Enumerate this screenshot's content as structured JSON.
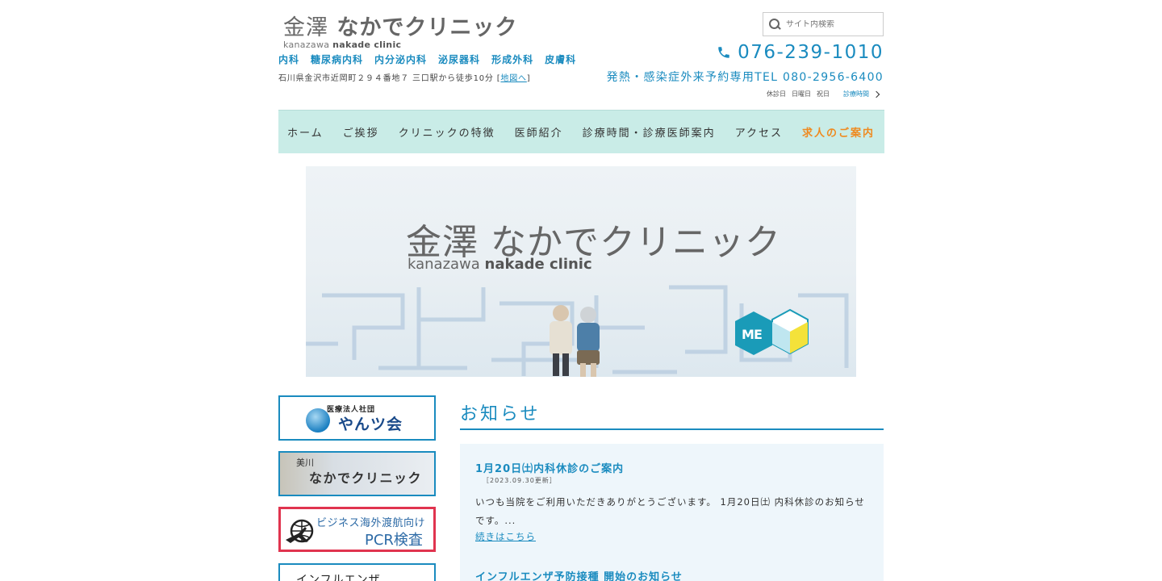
{
  "header": {
    "logo_kanji": "金澤",
    "logo_kana": "なかでクリニック",
    "logo_en_light": "kanazawa",
    "logo_en_bold": "nakade clinic",
    "search_placeholder": "サイト内検索",
    "departments": [
      "内科",
      "糖尿病内科",
      "内分泌内科",
      "泌尿器科",
      "形成外科",
      "皮膚科"
    ],
    "phone": "076-239-1010",
    "address": "石川県金沢市近岡町２９４番地７ 三口駅から徒歩10分",
    "map_link": "地図へ",
    "fever_line": "発熱・感染症外来予約専用TEL 080-2956-6400",
    "holiday_label": "休診日",
    "holiday_sun": "日曜日",
    "holiday_nat": "祝日",
    "hours_link": "診療時間"
  },
  "nav": {
    "items": [
      "ホーム",
      "ご挨拶",
      "クリニックの特徴",
      "医師紹介",
      "診療時間・診療医師案内",
      "アクセス",
      "求人のご案内"
    ]
  },
  "hero": {
    "title": "金澤 なかでクリニック",
    "sub_light": "kanazawa",
    "sub_bold": "nakade clinic",
    "badge": "ME"
  },
  "sidebar": {
    "banner1_small": "医療法人社団",
    "banner1_big": "やんツ会",
    "banner2_small": "美川",
    "banner2_big": "なかでクリニック",
    "banner3_line1": "ビジネス海外渡航向け",
    "banner3_line2": "PCR検査",
    "banner4_line1": "インフルエンザ"
  },
  "news": {
    "title": "お知らせ",
    "items": [
      {
        "heading": "1月20日㈯内科休診のご案内",
        "date": "［2023.09.30更新］",
        "body": "いつも当院をご利用いただきありがとうございます。 1月20日㈯ 内科休診のお知らせです。...",
        "more": "続きはこちら"
      },
      {
        "heading": "インフルエンザ予防接種 開始のお知らせ"
      }
    ]
  },
  "colors": {
    "accent": "#1a8bbf",
    "nav_bg": "#c9ece7",
    "recruit": "#ef8a1f",
    "pcr_border": "#e0344f"
  }
}
